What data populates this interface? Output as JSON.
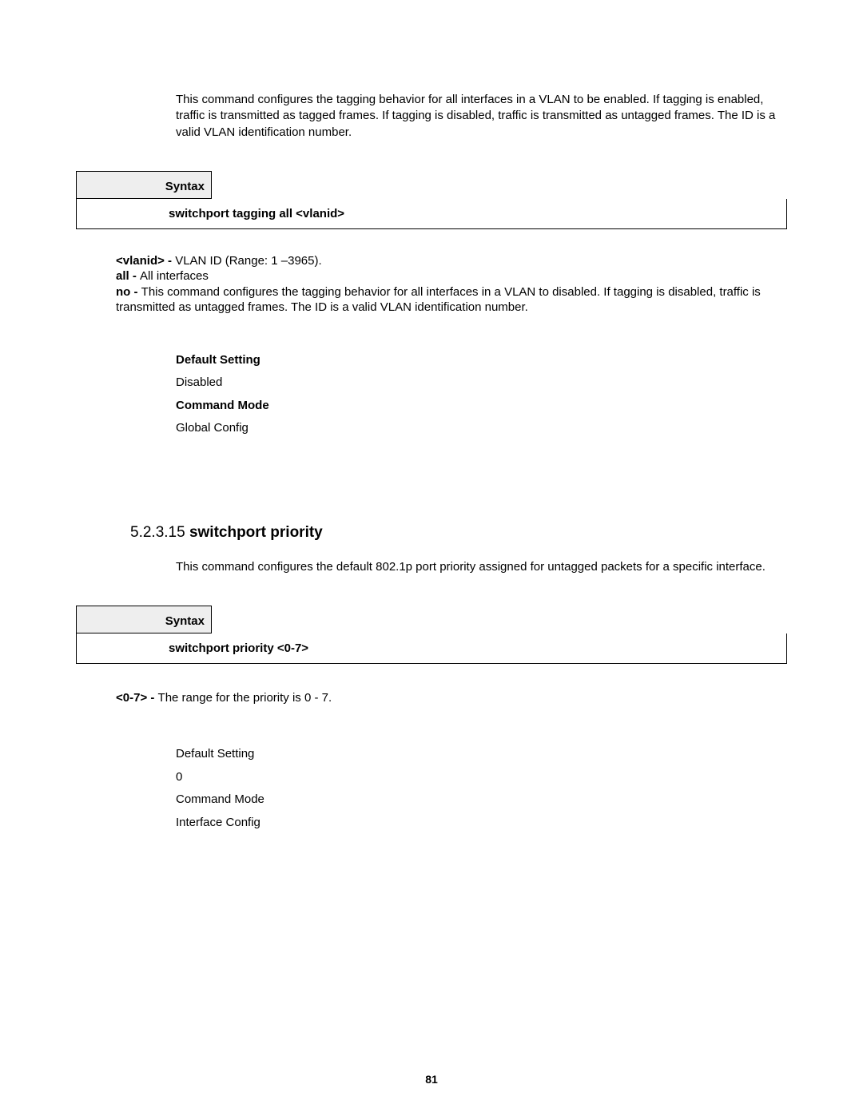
{
  "intro1": "This command configures the tagging behavior for all interfaces in a VLAN to be enabled. If tagging is enabled, traffic is transmitted as tagged frames. If tagging is disabled, traffic is transmitted as untagged frames. The ID is a valid VLAN identification number.",
  "syntax1": {
    "label": "Syntax",
    "command": "switchport tagging all <vlanid>"
  },
  "params1": {
    "p1_key": "<vlanid> - ",
    "p1_val": "VLAN ID (Range: 1 –3965).",
    "p2_key": "all - ",
    "p2_val": "All interfaces",
    "p3_key": "no - ",
    "p3_val": "This command configures the tagging behavior for all interfaces in a VLAN to disabled. If tagging is disabled, traffic is transmitted as untagged frames. The ID is a valid VLAN identification number."
  },
  "settings1": {
    "default_label": "Default Setting",
    "default_value": "Disabled",
    "mode_label": "Command Mode",
    "mode_value": "Global Config"
  },
  "section": {
    "number": "5.2.3.15 ",
    "title": "switchport priority"
  },
  "intro2": "This command configures the default 802.1p port priority assigned for untagged packets for a specific interface.",
  "syntax2": {
    "label": "Syntax",
    "command": "switchport priority <0-7>"
  },
  "params2": {
    "p1_key": "<0-7> - ",
    "p1_val": "The range for the priority is 0 - 7."
  },
  "settings2": {
    "default_label": "Default Setting",
    "default_value": "0",
    "mode_label": "Command Mode",
    "mode_value": "Interface Config"
  },
  "page_number": "81"
}
